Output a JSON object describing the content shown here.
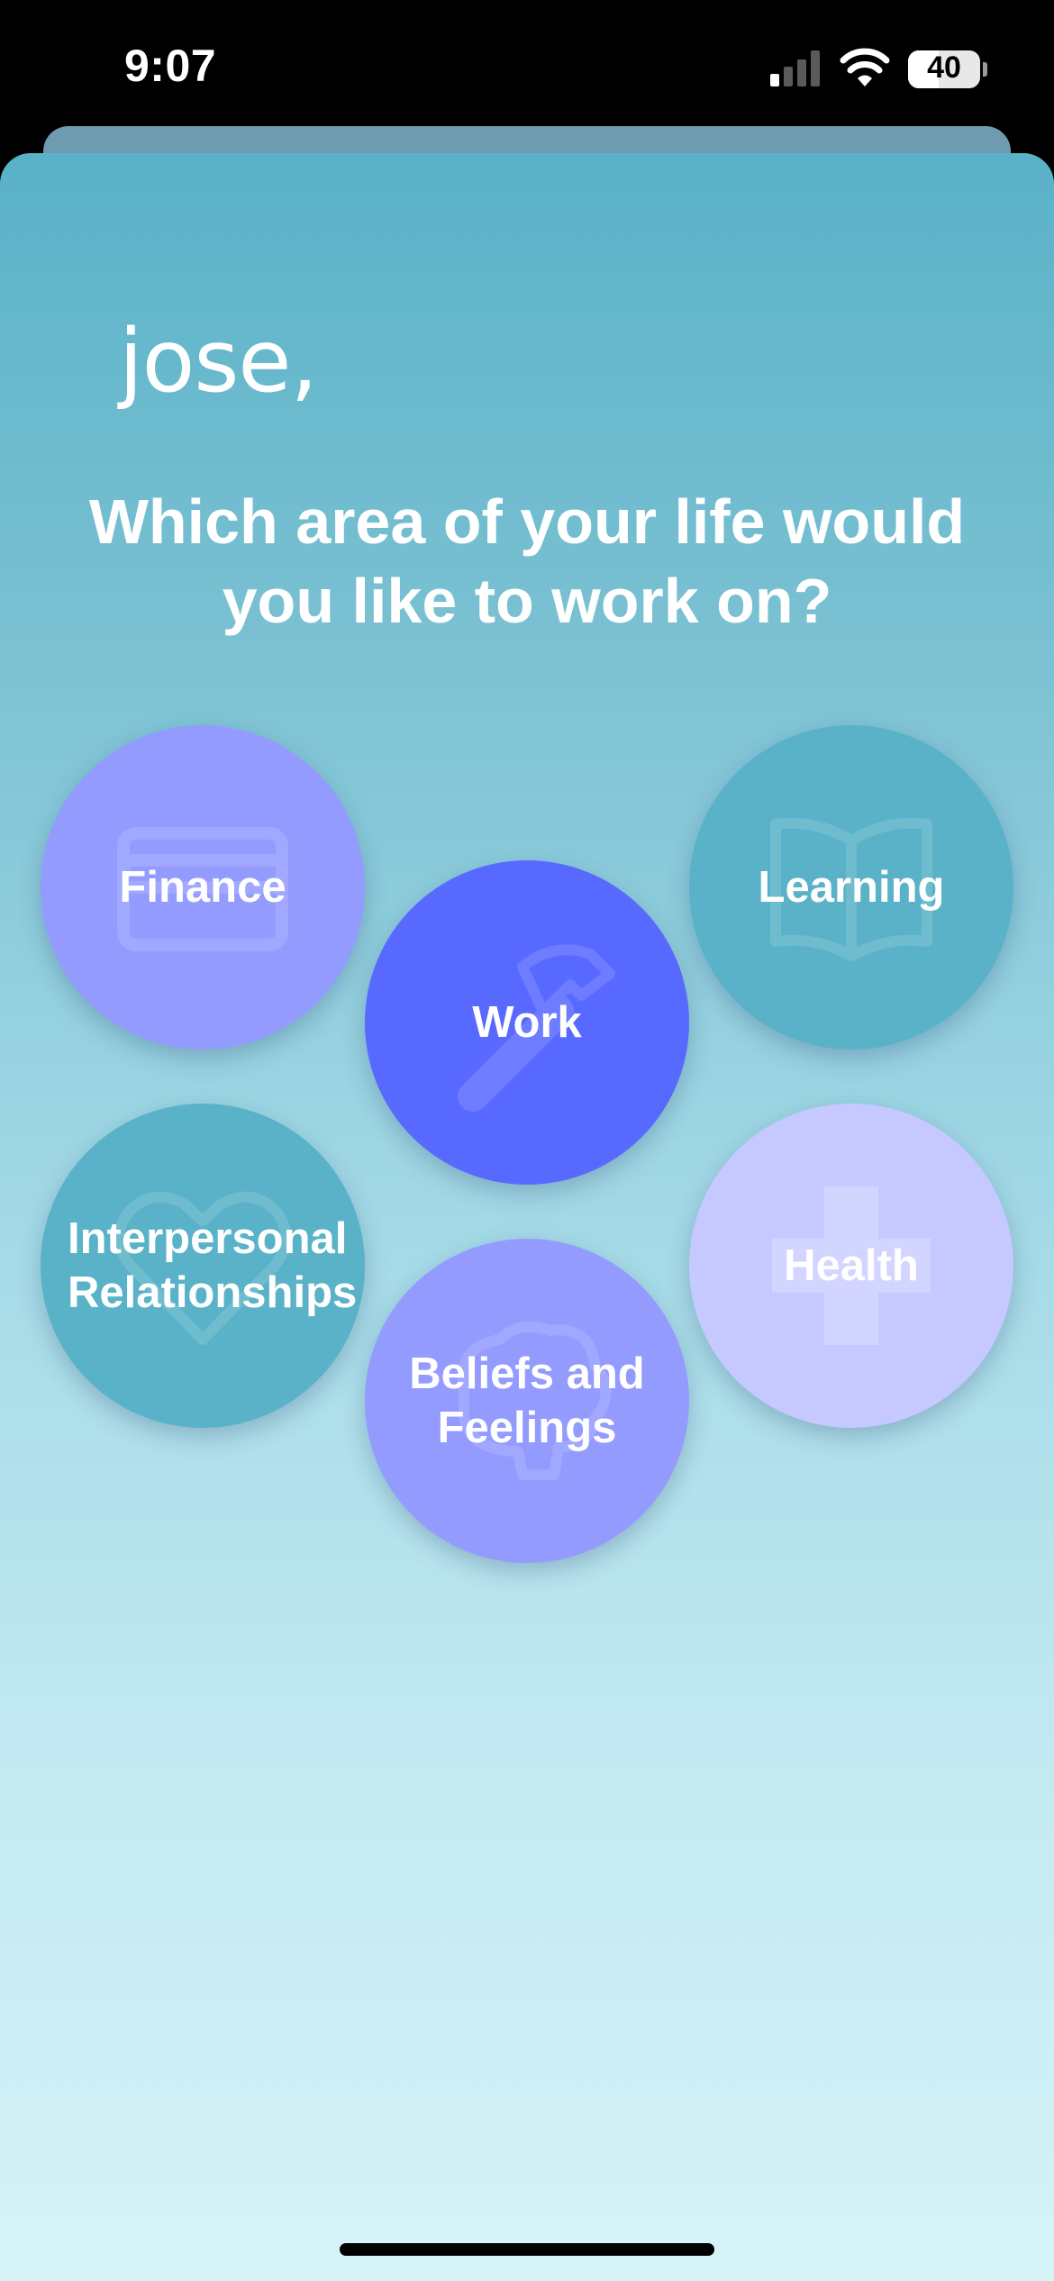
{
  "status_bar": {
    "time": "9:07",
    "battery": "40"
  },
  "header": {
    "greeting": "jose,",
    "question_line1": "Which area of your life would",
    "question_line2": "you like to work on?"
  },
  "areas": [
    {
      "label": "Finance",
      "icon": "credit-card-icon",
      "color": "#939bff"
    },
    {
      "label": "Work",
      "icon": "hammer-icon",
      "color": "#5869ff",
      "selected": true
    },
    {
      "label": "Learning",
      "icon": "open-book-icon",
      "color": "#5ab2c8"
    },
    {
      "label": "Interpersonal Relationships",
      "icon": "heart-icon",
      "color": "#5ab2c8"
    },
    {
      "label": "Health",
      "icon": "medical-cross-icon",
      "color": "#c6c9ff"
    },
    {
      "label": "Beliefs and Feelings",
      "icon": "brain-icon",
      "color": "#939bff"
    }
  ]
}
